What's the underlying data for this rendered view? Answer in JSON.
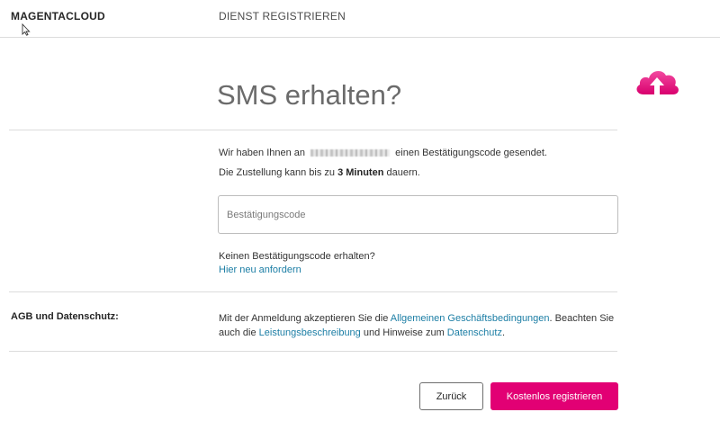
{
  "header": {
    "brand": "MAGENTACLOUD",
    "service": "DIENST REGISTRIEREN"
  },
  "main": {
    "title": "SMS erhalten?",
    "sent_prefix": "Wir haben Ihnen an",
    "sent_suffix": "einen Bestätigungscode gesendet.",
    "delivery_prefix": "Die Zustellung kann bis zu",
    "delivery_time": "3 Minuten",
    "delivery_suffix": "dauern.",
    "code_placeholder": "Bestätigungscode",
    "code_value": "",
    "no_code_text": "Keinen Bestätigungscode erhalten?",
    "resend_link": "Hier neu anfordern"
  },
  "terms": {
    "label": "AGB und Datenschutz:",
    "text_1": "Mit der Anmeldung akzeptieren Sie die",
    "link_agb": "Allgemeinen Geschäftsbedingungen",
    "text_2": ". Beachten Sie auch die",
    "link_leistung": "Leistungsbeschreibung",
    "text_3": "und Hinweise zum",
    "link_datenschutz": "Datenschutz",
    "text_4": "."
  },
  "actions": {
    "back_label": "Zurück",
    "register_label": "Kostenlos registrieren"
  },
  "colors": {
    "brand_magenta": "#e20074",
    "link_blue": "#1c7ea5"
  },
  "icons": {
    "logo": "cloud-upload-icon",
    "pointer": "mouse-cursor-icon"
  }
}
